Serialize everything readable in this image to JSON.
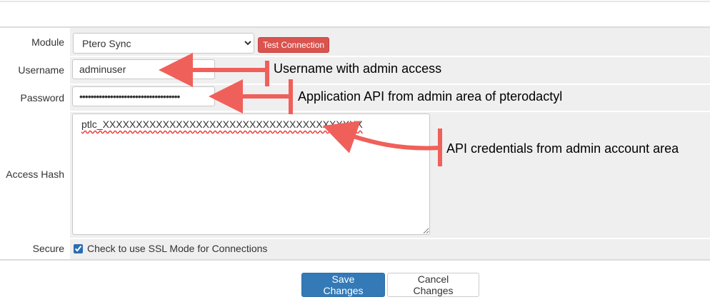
{
  "form": {
    "module": {
      "label": "Module",
      "selected": "Ptero Sync",
      "test_button": "Test Connection"
    },
    "username": {
      "label": "Username",
      "value": "adminuser"
    },
    "password": {
      "label": "Password",
      "value": "••••••••••••••••••••••••••••••••••••"
    },
    "access_hash": {
      "label": "Access Hash",
      "value": "ptlc_XXXXXXXXXXXXXXXXXXXXXXXXXXXXXXXXXXXXXXX"
    },
    "secure": {
      "label": "Secure",
      "checked": true,
      "text": "Check to use SSL Mode for Connections"
    }
  },
  "actions": {
    "save": "Save Changes",
    "cancel": "Cancel Changes"
  },
  "annotations": {
    "username_note": "Username with admin access",
    "password_note": "Application API from admin area of pterodactyl",
    "hash_note": "API credentials from admin account area"
  },
  "colors": {
    "annotation_arrow": "#f0605a",
    "save_button": "#337ab7",
    "test_button": "#d9534f"
  }
}
